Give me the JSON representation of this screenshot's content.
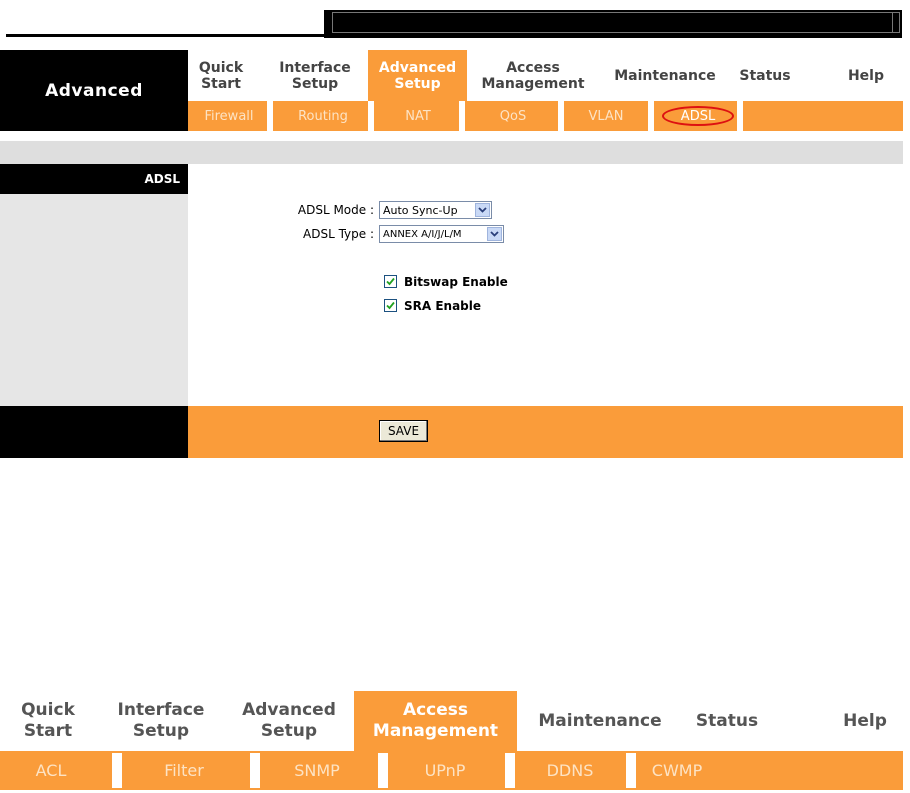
{
  "header": {
    "brand": "Advanced",
    "nav": [
      {
        "label": "Quick Start",
        "active": false
      },
      {
        "label": "Interface Setup",
        "active": false
      },
      {
        "label": "Advanced Setup",
        "active": true
      },
      {
        "label": "Access Management",
        "active": false
      },
      {
        "label": "Maintenance",
        "active": false
      },
      {
        "label": "Status",
        "active": false
      },
      {
        "label": "Help",
        "active": false
      }
    ],
    "subnav": [
      "Firewall",
      "Routing",
      "NAT",
      "QoS",
      "VLAN",
      "ADSL"
    ],
    "highlighted_subnav": "ADSL",
    "highlight_color": "#dd1111"
  },
  "section": {
    "title": "ADSL"
  },
  "form": {
    "adsl_mode_label": "ADSL Mode :",
    "adsl_mode_value": "Auto Sync-Up",
    "adsl_type_label": "ADSL Type :",
    "adsl_type_value": "ANNEX A/I/J/L/M",
    "bitswap_label": "Bitswap Enable",
    "bitswap_checked": true,
    "sra_label": "SRA Enable",
    "sra_checked": true,
    "save_label": "SAVE"
  },
  "nav2": {
    "items": [
      {
        "label": "Quick Start",
        "active": false
      },
      {
        "label": "Interface Setup",
        "active": false
      },
      {
        "label": "Advanced Setup",
        "active": false
      },
      {
        "label": "Access Management",
        "active": true
      },
      {
        "label": "Maintenance",
        "active": false
      },
      {
        "label": "Status",
        "active": false
      },
      {
        "label": "Help",
        "active": false
      }
    ],
    "subnav": [
      "ACL",
      "Filter",
      "SNMP",
      "UPnP",
      "DDNS",
      "CWMP"
    ]
  },
  "colors": {
    "accent_orange": "#fa9c3a",
    "black": "#000000",
    "gray": "#dedede"
  }
}
